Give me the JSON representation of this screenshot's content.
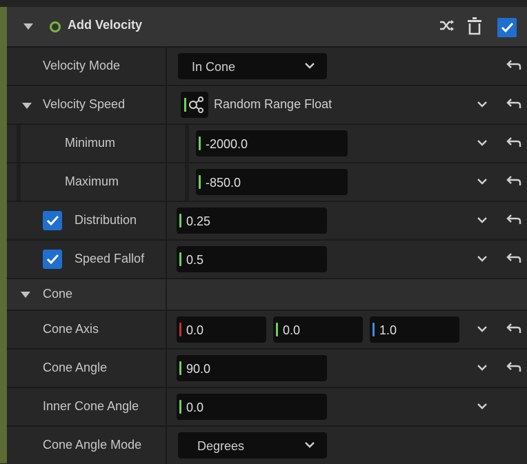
{
  "colors": {
    "panel_bg": "#242424",
    "header_bg": "#343434",
    "accent": "#5d6b35",
    "checkbox_blue": "#1f6fcf",
    "green_mark": "#6ed05a",
    "red_mark": "#c8302e",
    "blue_mark": "#3a8ee8"
  },
  "header": {
    "title": "Add Velocity",
    "collapse_icon": "triangle-down-icon",
    "status_icon": "ring-icon",
    "actions": [
      "shuffle-icon",
      "trash-icon",
      "checkmark-icon"
    ],
    "enabled": true
  },
  "rows": {
    "velocity_mode": {
      "label": "Velocity Mode",
      "value": "In Cone"
    },
    "velocity_speed": {
      "label": "Velocity Speed",
      "value": "Random Range Float",
      "icon": "node-graph-icon"
    },
    "minimum": {
      "label": "Minimum",
      "value": "-2000.0"
    },
    "maximum": {
      "label": "Maximum",
      "value": "-850.0"
    },
    "distribution": {
      "label": "Distribution",
      "value": "0.25",
      "checked": true
    },
    "speed_falloff": {
      "label": "Speed Fallof",
      "value": "0.5",
      "checked": true
    },
    "cone": {
      "label": "Cone"
    },
    "cone_axis": {
      "label": "Cone Axis",
      "x": "0.0",
      "y": "0.0",
      "z": "1.0"
    },
    "cone_angle": {
      "label": "Cone Angle",
      "value": "90.0"
    },
    "inner_cone_angle": {
      "label": "Inner Cone Angle",
      "value": "0.0"
    },
    "cone_angle_mode": {
      "label": "Cone Angle Mode",
      "value": "Degrees"
    }
  }
}
